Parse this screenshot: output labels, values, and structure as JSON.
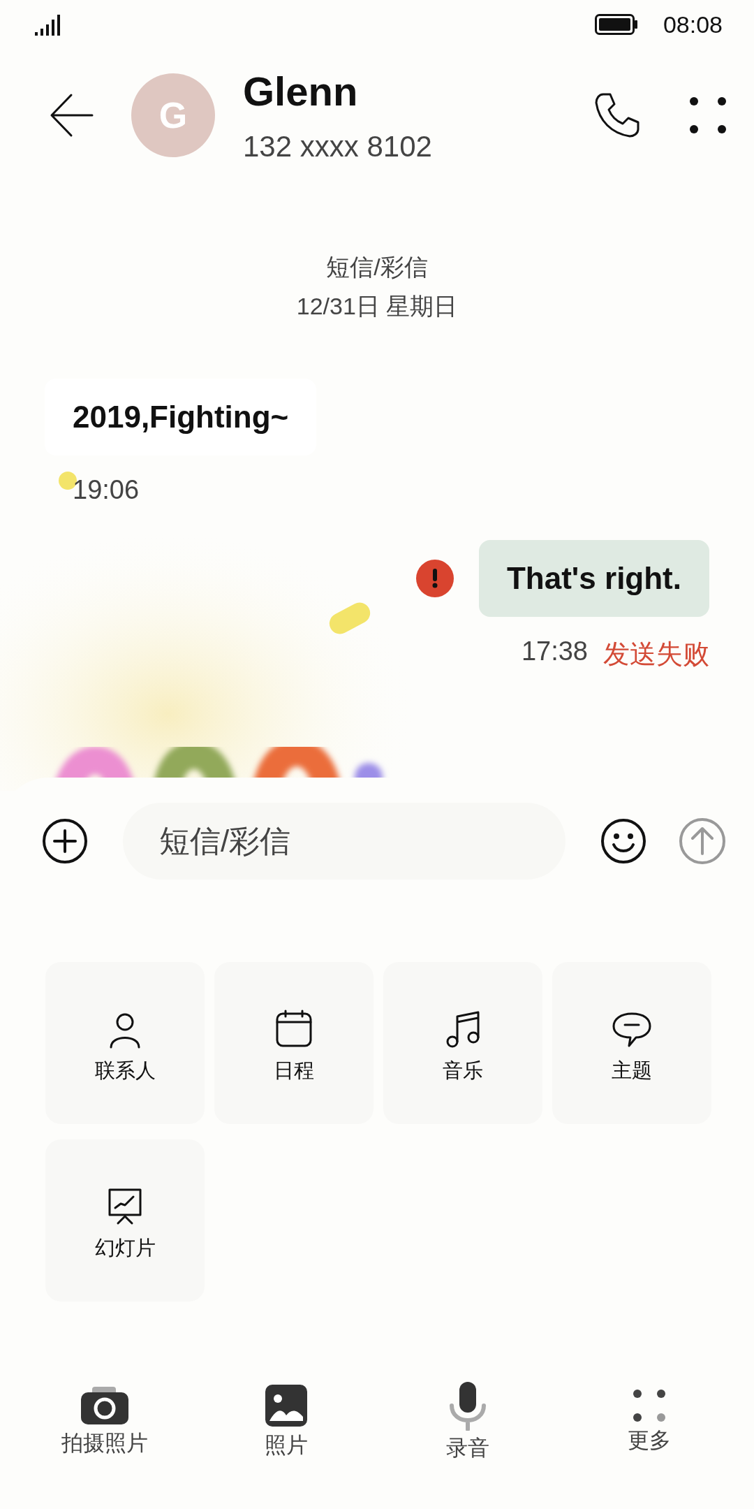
{
  "status_bar": {
    "time": "08:08"
  },
  "contact": {
    "initial": "G",
    "name": "Glenn",
    "number": "132 xxxx 8102"
  },
  "thread": {
    "channel": "短信/彩信",
    "date": "12/31日 星期日"
  },
  "messages": [
    {
      "kind": "incoming",
      "text": "2019,Fighting~",
      "time": "19:06",
      "failed": false
    },
    {
      "kind": "outgoing",
      "text": "That's right.",
      "time": "17:38",
      "failed": true,
      "status": "发送失败"
    }
  ],
  "composer": {
    "placeholder": "短信/彩信",
    "send_disabled": true
  },
  "attachments": [
    {
      "label": "联系人"
    },
    {
      "label": "日程"
    },
    {
      "label": "音乐"
    },
    {
      "label": "主题"
    },
    {
      "label": "幻灯片"
    }
  ],
  "bottom_actions": [
    {
      "label": "拍摄照片"
    },
    {
      "label": "照片"
    },
    {
      "label": "录音"
    },
    {
      "label": "更多"
    }
  ]
}
